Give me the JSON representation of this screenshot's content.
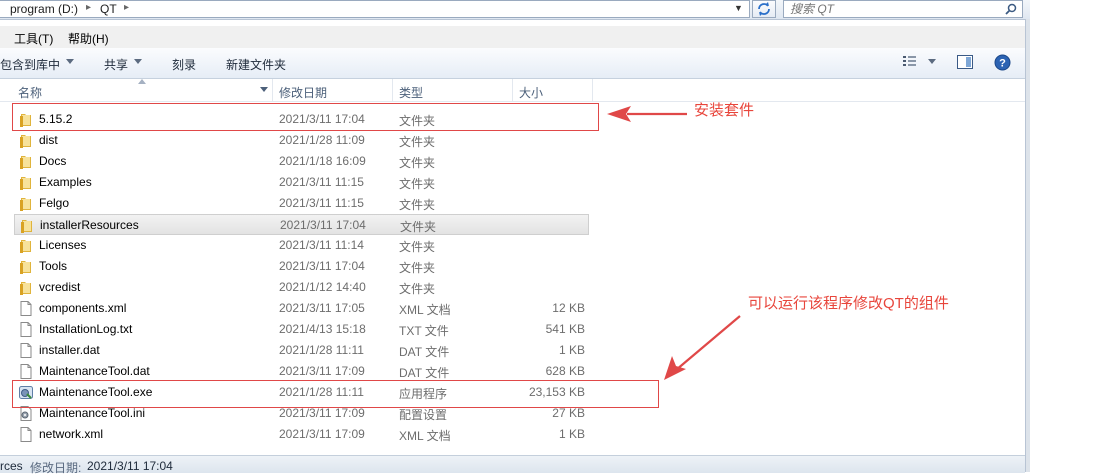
{
  "address": {
    "segments": [
      "program (D:)",
      "QT"
    ],
    "search_placeholder": "搜索 QT"
  },
  "menu": [
    "工具(T)",
    "帮助(H)"
  ],
  "toolbar": {
    "include_in_library": "包含到库中",
    "share": "共享",
    "burn": "刻录",
    "new_folder": "新建文件夹"
  },
  "columns": {
    "name": "名称",
    "date": "修改日期",
    "type": "类型",
    "size": "大小"
  },
  "files": [
    {
      "name": "5.15.2",
      "date": "2021/3/11 17:04",
      "type": "文件夹",
      "size": "",
      "icon": "folder-icon"
    },
    {
      "name": "dist",
      "date": "2021/1/28 11:09",
      "type": "文件夹",
      "size": "",
      "icon": "folder-icon"
    },
    {
      "name": "Docs",
      "date": "2021/1/18 16:09",
      "type": "文件夹",
      "size": "",
      "icon": "folder-icon"
    },
    {
      "name": "Examples",
      "date": "2021/3/11 11:15",
      "type": "文件夹",
      "size": "",
      "icon": "folder-icon"
    },
    {
      "name": "Felgo",
      "date": "2021/3/11 11:15",
      "type": "文件夹",
      "size": "",
      "icon": "folder-icon"
    },
    {
      "name": "installerResources",
      "date": "2021/3/11 17:04",
      "type": "文件夹",
      "size": "",
      "icon": "folder-icon"
    },
    {
      "name": "Licenses",
      "date": "2021/3/11 11:14",
      "type": "文件夹",
      "size": "",
      "icon": "folder-icon"
    },
    {
      "name": "Tools",
      "date": "2021/3/11 17:04",
      "type": "文件夹",
      "size": "",
      "icon": "folder-icon"
    },
    {
      "name": "vcredist",
      "date": "2021/1/12 14:40",
      "type": "文件夹",
      "size": "",
      "icon": "folder-icon"
    },
    {
      "name": "components.xml",
      "date": "2021/3/11 17:05",
      "type": "XML 文档",
      "size": "12 KB",
      "icon": "document-icon"
    },
    {
      "name": "InstallationLog.txt",
      "date": "2021/4/13 15:18",
      "type": "TXT 文件",
      "size": "541 KB",
      "icon": "document-icon"
    },
    {
      "name": "installer.dat",
      "date": "2021/1/28 11:11",
      "type": "DAT 文件",
      "size": "1 KB",
      "icon": "document-icon"
    },
    {
      "name": "MaintenanceTool.dat",
      "date": "2021/3/11 17:09",
      "type": "DAT 文件",
      "size": "628 KB",
      "icon": "document-icon"
    },
    {
      "name": "MaintenanceTool.exe",
      "date": "2021/1/28 11:11",
      "type": "应用程序",
      "size": "23,153 KB",
      "icon": "app-icon"
    },
    {
      "name": "MaintenanceTool.ini",
      "date": "2021/3/11 17:09",
      "type": "配置设置",
      "size": "27 KB",
      "icon": "settings-file-icon"
    },
    {
      "name": "network.xml",
      "date": "2021/3/11 17:09",
      "type": "XML 文档",
      "size": "1 KB",
      "icon": "document-icon"
    }
  ],
  "annotations": {
    "install_kit": "安装套件",
    "maintenance_note": "可以运行该程序修改QT的组件",
    "color": "#e8463c"
  },
  "status": {
    "name_fragment": "rces",
    "modified_label": "修改日期:",
    "modified_value": "2021/3/11 17:04"
  }
}
